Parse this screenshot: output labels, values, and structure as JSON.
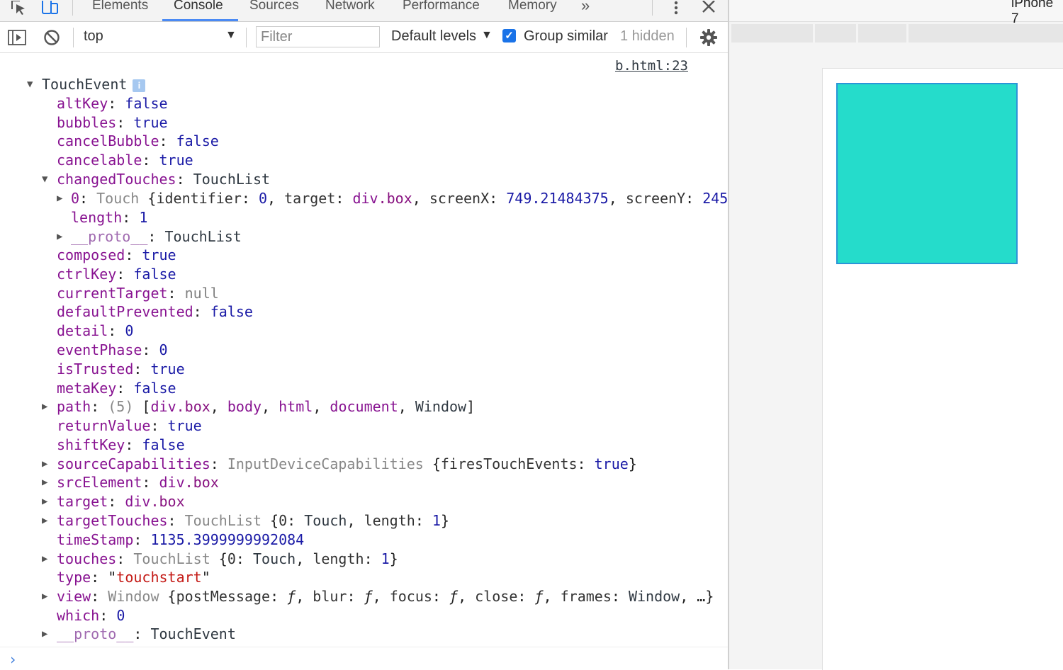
{
  "tabs": [
    "Elements",
    "Console",
    "Sources",
    "Network",
    "Performance",
    "Memory"
  ],
  "tab_more": "»",
  "toolbar": {
    "context": "top",
    "filter_placeholder": "Filter",
    "levels": "Default levels",
    "group_similar": "Group similar",
    "hidden": "1 hidden"
  },
  "source_link": "b.html:23",
  "event_name": "TouchEvent",
  "lines": {
    "altKey": [
      "altKey",
      "false"
    ],
    "bubbles": [
      "bubbles",
      "true"
    ],
    "cancelBubble": [
      "cancelBubble",
      "false"
    ],
    "cancelable": [
      "cancelable",
      "true"
    ],
    "changedTouches": [
      "changedTouches",
      "TouchList"
    ],
    "touch0": {
      "index": "0",
      "cls": "Touch",
      "identifier_key": "identifier",
      "identifier_val": "0",
      "target_key": "target",
      "target_tag": "div",
      "target_cls": ".box",
      "screenX_key": "screenX",
      "screenX_val": "749.21484375",
      "screenY_key": "screenY",
      "screenY_val": "245"
    },
    "length": [
      "length",
      "1"
    ],
    "proto1": [
      "__proto__",
      "TouchList"
    ],
    "composed": [
      "composed",
      "true"
    ],
    "ctrlKey": [
      "ctrlKey",
      "false"
    ],
    "currentTarget": [
      "currentTarget",
      "null"
    ],
    "defaultPrevented": [
      "defaultPrevented",
      "false"
    ],
    "detail": [
      "detail",
      "0"
    ],
    "eventPhase": [
      "eventPhase",
      "0"
    ],
    "isTrusted": [
      "isTrusted",
      "true"
    ],
    "metaKey": [
      "metaKey",
      "false"
    ],
    "path": {
      "key": "path",
      "count": "(5)",
      "i1": "div",
      "i1c": ".box",
      "i2": "body",
      "i3": "html",
      "i4": "document",
      "i5": "Window"
    },
    "returnValue": [
      "returnValue",
      "true"
    ],
    "shiftKey": [
      "shiftKey",
      "false"
    ],
    "sourceCapabilities": {
      "key": "sourceCapabilities",
      "cls": "InputDeviceCapabilities",
      "ik": "firesTouchEvents",
      "iv": "true"
    },
    "srcElement": {
      "key": "srcElement",
      "tag": "div",
      "cls": ".box"
    },
    "target": {
      "key": "target",
      "tag": "div",
      "cls": ".box"
    },
    "targetTouches": {
      "key": "targetTouches",
      "cls": "TouchList",
      "k0": "0",
      "v0": "Touch",
      "kl": "length",
      "vl": "1"
    },
    "timeStamp": [
      "timeStamp",
      "1135.3999999992084"
    ],
    "touches": {
      "key": "touches",
      "cls": "TouchList",
      "k0": "0",
      "v0": "Touch",
      "kl": "length",
      "vl": "1"
    },
    "type": [
      "type",
      "touchstart"
    ],
    "view": {
      "key": "view",
      "cls": "Window",
      "a": "postMessage",
      "b": "blur",
      "c": "focus",
      "d": "close",
      "e": "frames",
      "ev": "Window",
      "f": "ƒ",
      "ellipsis": "…"
    },
    "which": [
      "which",
      "0"
    ],
    "proto2": [
      "__proto__",
      "TouchEvent"
    ]
  },
  "device": "iPhone 7",
  "colors": {
    "box_fill": "#25dccb",
    "box_border": "#2b95d8",
    "accent": "#1a73e8"
  }
}
